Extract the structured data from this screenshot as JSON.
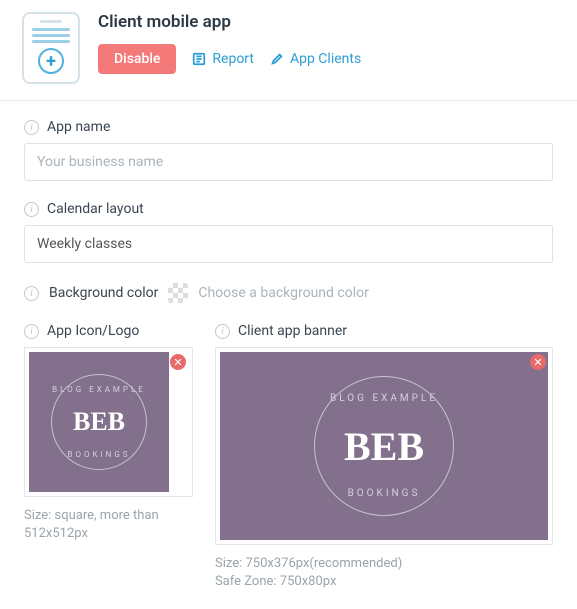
{
  "header": {
    "title": "Client mobile app",
    "disable_label": "Disable",
    "report_label": "Report",
    "clients_label": "App Clients"
  },
  "fields": {
    "app_name_label": "App name",
    "app_name_placeholder": "Your business name",
    "calendar_label": "Calendar layout",
    "calendar_value": "Weekly classes",
    "bg_label": "Background color",
    "bg_prompt": "Choose a background color"
  },
  "logo": {
    "label": "App Icon/Logo",
    "caption": "Size: square, more than 512x512px",
    "brand_top": "BLOG EXAMPLE",
    "brand_center": "BEB",
    "brand_bottom": "BOOKINGS"
  },
  "banner": {
    "label": "Client app banner",
    "caption1": "Size: 750x376px(recommended)",
    "caption2": "Safe Zone: 750x80px"
  }
}
